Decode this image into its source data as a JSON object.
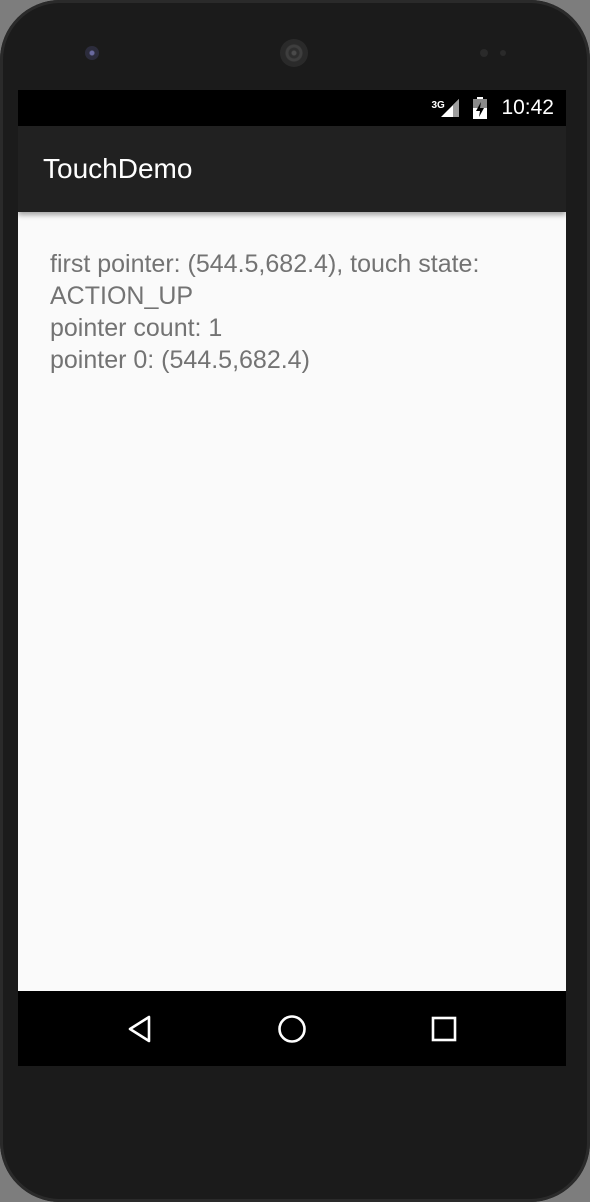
{
  "status_bar": {
    "network_type": "3G",
    "time": "10:42",
    "signal_icon": "cell-signal-icon",
    "battery_icon": "battery-charging-icon"
  },
  "app_bar": {
    "title": "TouchDemo"
  },
  "content": {
    "lines": [
      "first pointer: (544.5,682.4), touch state:",
      "ACTION_UP",
      "pointer count: 1",
      "pointer 0: (544.5,682.4)"
    ]
  },
  "nav_bar": {
    "buttons": [
      "back-icon",
      "home-icon",
      "recent-apps-icon"
    ]
  },
  "colors": {
    "device_frame": "#1b1b1b",
    "status_bar": "#000000",
    "app_bar": "#212121",
    "screen_background": "#fafafa",
    "body_text": "#737373"
  }
}
